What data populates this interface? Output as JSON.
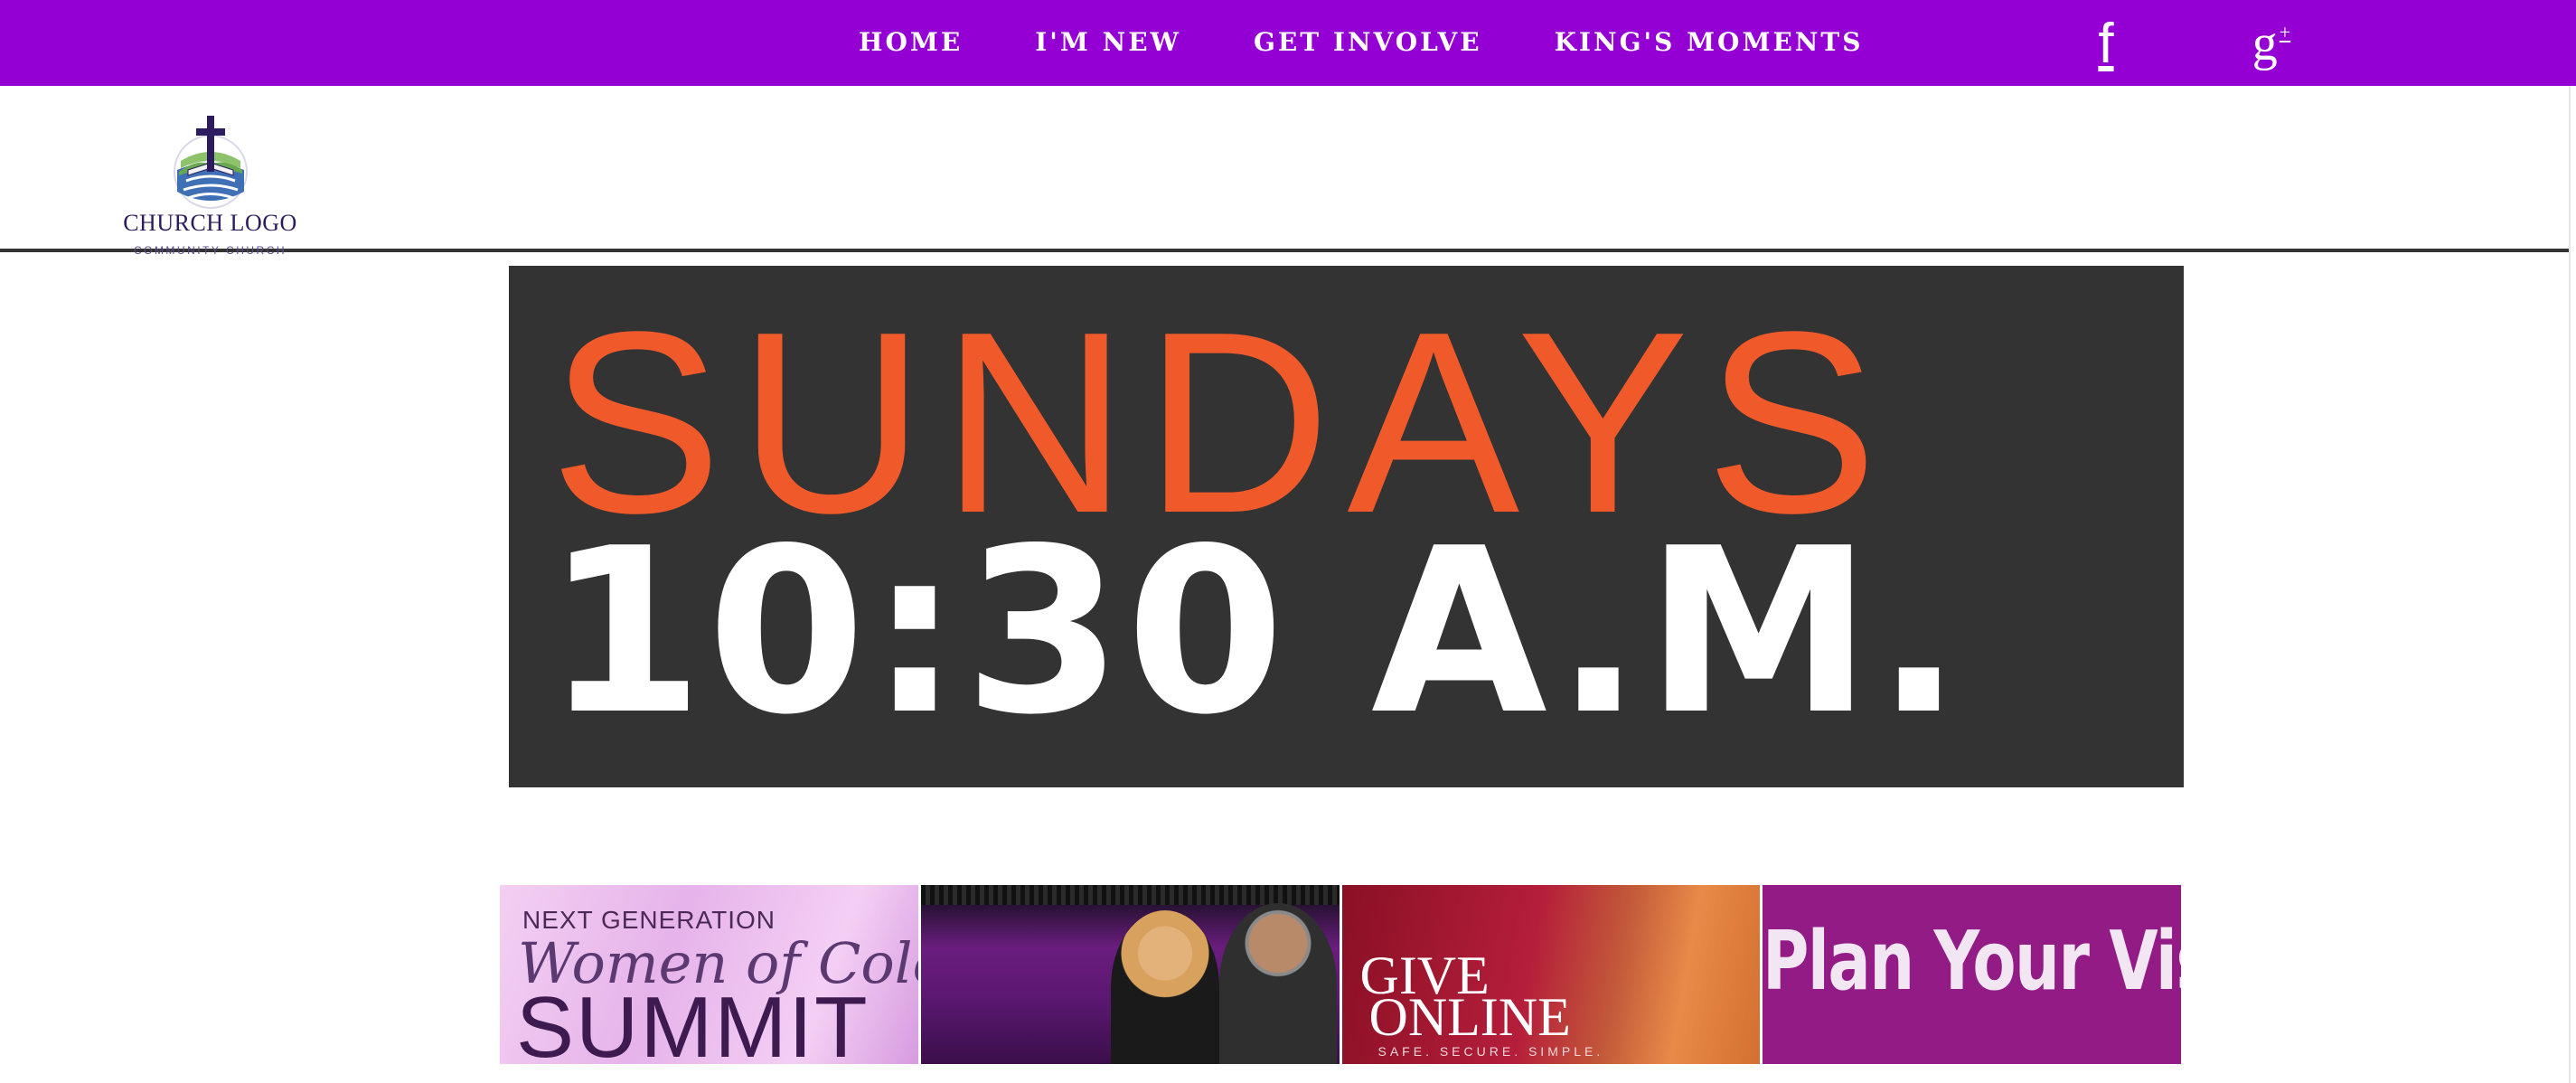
{
  "nav": {
    "items": [
      {
        "label": "HOME"
      },
      {
        "label": "I'M NEW"
      },
      {
        "label": "GET INVOLVE"
      },
      {
        "label": "KING'S MOMENTS"
      }
    ],
    "social": {
      "facebook": "f",
      "googleplus": "g",
      "googleplus_sup": "+"
    }
  },
  "logo": {
    "title": "CHURCH LOGO",
    "subtitle": "COMMUNITY CHURCH"
  },
  "hero": {
    "line1": "SUNDAYS",
    "line2": "10:30 A.M."
  },
  "tiles": {
    "t1": {
      "small": "NEXT GENERATION",
      "script": "Women of Color",
      "big": "SUMMIT"
    },
    "t3": {
      "line1": "GIVE",
      "line2": "ONLINE",
      "sub": "SAFE. SECURE. SIMPLE."
    },
    "t4": {
      "text": "Plan Your Visit"
    }
  },
  "colors": {
    "nav_bg": "#9400d3",
    "hero_bg": "#333333",
    "hero_accent": "#f05a2a"
  }
}
